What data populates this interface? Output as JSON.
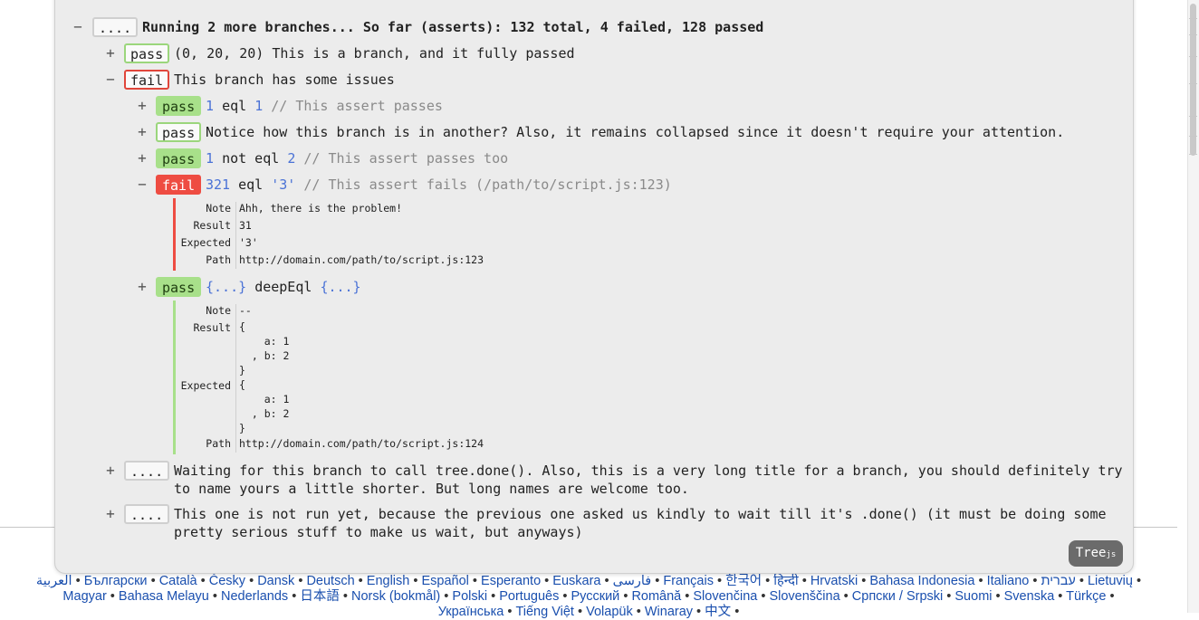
{
  "root": {
    "toggle": "−",
    "badge": "....",
    "title": "Running 2 more branches... So far (asserts): 132 total, 4 failed, 128 passed"
  },
  "branch1": {
    "toggle": "+",
    "badge": "pass",
    "title": "(0, 20, 20) This is a branch, and it fully passed"
  },
  "branch2": {
    "toggle": "−",
    "badge": "fail",
    "title": "This branch has some issues",
    "a1": {
      "toggle": "+",
      "badge": "pass",
      "lhs": "1",
      "op": "eql",
      "rhs": "1",
      "comment": "// This assert passes"
    },
    "a2": {
      "toggle": "+",
      "badge": "pass",
      "title": "Notice how this branch is in another? Also, it remains collapsed since it doesn't require your attention."
    },
    "a3": {
      "toggle": "+",
      "badge": "pass",
      "lhs": "1",
      "op": "not eql",
      "rhs": "2",
      "comment": "// This assert passes too"
    },
    "a4": {
      "toggle": "−",
      "badge": "fail",
      "lhs": "321",
      "op": "eql",
      "rhs": "'3'",
      "comment": "// This assert fails (/path/to/script.js:123)",
      "details": {
        "note_k": "Note",
        "note_v": "Ahh, there is the problem!",
        "result_k": "Result",
        "result_v": "31",
        "expected_k": "Expected",
        "expected_v": "'3'",
        "path_k": "Path",
        "path_v": "http://domain.com/path/to/script.js:123"
      }
    },
    "a5": {
      "toggle": "+",
      "badge": "pass",
      "lhs": "{...}",
      "op": "deepEql",
      "rhs": "{...}",
      "details": {
        "note_k": "Note",
        "note_v": "--",
        "result_k": "Result",
        "result_v": "{\n    a: 1\n  , b: 2\n}",
        "expected_k": "Expected",
        "expected_v": "{\n    a: 1\n  , b: 2\n}",
        "path_k": "Path",
        "path_v": "http://domain.com/path/to/script.js:124"
      }
    }
  },
  "branch3": {
    "toggle": "+",
    "badge": "....",
    "title_l1": "Waiting for this branch to call tree.done(). Also, this is a very long title for a branch, you should definitely try",
    "title_l2": "to name yours a little shorter. But long names are welcome too."
  },
  "branch4": {
    "toggle": "+",
    "badge": "....",
    "title_l1": "This one is not run yet, because the previous one asked us kindly to wait till it's .done() (it must be doing some",
    "title_l2": "pretty serious stuff to make us wait, but anyways)"
  },
  "logo": {
    "main": "Tree",
    "sub": "js"
  },
  "colors": {
    "pass": "#a8e08a",
    "fail": "#ee4c42",
    "accent": "#4a72d6"
  },
  "languages_line1": [
    "العربية",
    "Български",
    "Català",
    "Česky",
    "Dansk",
    "Deutsch",
    "English",
    "Español",
    "Esperanto",
    "Euskara",
    "فارسی",
    "Français",
    "한국어",
    "हिन्दी",
    "Hrvatski",
    "Bahasa Indonesia",
    "Italiano",
    "עברית",
    "Lietuvių"
  ],
  "languages_line2": [
    "Magyar",
    "Bahasa Melayu",
    "Nederlands",
    "日本語",
    "Norsk (bokmål)",
    "Polski",
    "Português",
    "Русский",
    "Română",
    "Slovenčina",
    "Slovenščina",
    "Српски / Srpski",
    "Suomi",
    "Svenska",
    "Türkçe"
  ],
  "languages_line3": [
    "Українська",
    "Tiếng Việt",
    "Volapük",
    "Winaray",
    "中文"
  ]
}
